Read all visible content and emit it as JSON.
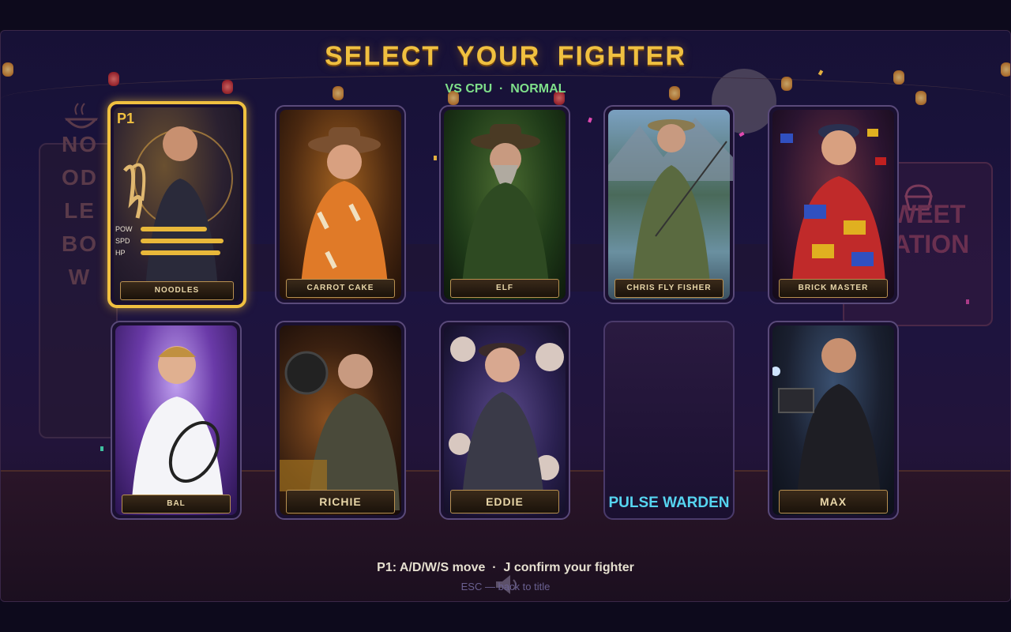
{
  "title": "SELECT YOUR FIGHTER",
  "subtitle": "VS CPU  ·  NORMAL",
  "background": {
    "left_sign": "NOODLE BOW",
    "right_sign": "WEET\nATION"
  },
  "fighters": [
    {
      "name": "NOODLES",
      "selected": true,
      "badge": "P1",
      "stats": [
        {
          "label": "POW",
          "value": 0.6
        },
        {
          "label": "SPD",
          "value": 0.75
        },
        {
          "label": "HP",
          "value": 0.72
        }
      ]
    },
    {
      "name": "CARROT CAKE"
    },
    {
      "name": "ELF"
    },
    {
      "name": "CHRIS FLY FISHER"
    },
    {
      "name": "BRICK MASTER"
    },
    {
      "name": "BAL"
    },
    {
      "name": "RICHIE"
    },
    {
      "name": "EDDIE"
    },
    {
      "name": "PULSE WARDEN",
      "empty": true
    },
    {
      "name": "MAX"
    }
  ],
  "controls_hint": "P1: A/D/W/S move  ·  J confirm your fighter",
  "back_hint": "ESC — back to title",
  "colors": {
    "accent": "#f0c040",
    "subtitle": "#7fe08a",
    "pulse": "#56d4f0"
  }
}
